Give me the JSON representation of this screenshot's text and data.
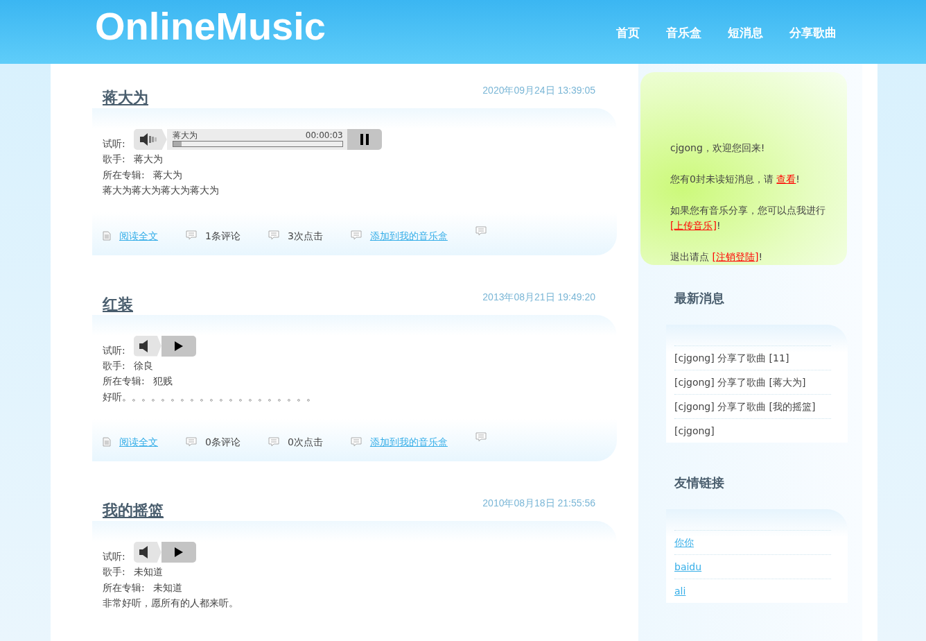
{
  "header": {
    "logo": "OnlineMusic",
    "nav": [
      {
        "label": "首页"
      },
      {
        "label": "音乐盒"
      },
      {
        "label": "短消息"
      },
      {
        "label": "分享歌曲"
      }
    ]
  },
  "posts": [
    {
      "title": "蒋大为",
      "date": "2020年09月24日 13:39:05",
      "listen_label": "试听:",
      "player": {
        "kind": "full",
        "playing": true,
        "track": "蒋大为",
        "time": "00:00:03",
        "level": 0.05
      },
      "singer_label": "歌手:",
      "singer": "蒋大为",
      "album_label": "所在专辑:",
      "album": "蒋大为",
      "description": "蒋大为蒋大为蒋大为蒋大为",
      "read_more": "阅读全文",
      "comments": "1条评论",
      "clicks": "3次点击",
      "add_link": "添加到我的音乐盒"
    },
    {
      "title": "红装",
      "date": "2013年08月21日 19:49:20",
      "listen_label": "试听:",
      "player": {
        "kind": "compact",
        "playing": false
      },
      "singer_label": "歌手:",
      "singer": "徐良",
      "album_label": "所在专辑:",
      "album": "犯贱",
      "description": "好听。。。。。。。。。。。。。。。。。。。。",
      "read_more": "阅读全文",
      "comments": "0条评论",
      "clicks": "0次点击",
      "add_link": "添加到我的音乐盒"
    },
    {
      "title": "我的摇篮",
      "date": "2010年08月18日 21:55:56",
      "listen_label": "试听:",
      "player": {
        "kind": "compact",
        "playing": false
      },
      "singer_label": "歌手:",
      "singer": "未知道",
      "album_label": "所在专辑:",
      "album": "未知道",
      "description": "非常好听，愿所有的人都来听。"
    }
  ],
  "welcome": {
    "greeting": "cjgong，欢迎您回来!",
    "messages_text": "您有0封未读短消息，请 ",
    "messages_link": "查看",
    "messages_end": "!",
    "share_text": "如果您有音乐分享，您可以点我进行 ",
    "share_link": "[上传音乐]",
    "share_end": "!",
    "logout_text": "退出请点 ",
    "logout_link": "[注销登陆]",
    "logout_end": "!"
  },
  "news": {
    "title": "最新消息",
    "items": [
      "[cjgong] 分享了歌曲 [11]",
      "[cjgong] 分享了歌曲 [蒋大为]",
      "[cjgong] 分享了歌曲 [我的摇篮]",
      "[cjgong]"
    ]
  },
  "links": {
    "title": "友情链接",
    "items": [
      "你你",
      "baidu",
      "ali"
    ]
  }
}
